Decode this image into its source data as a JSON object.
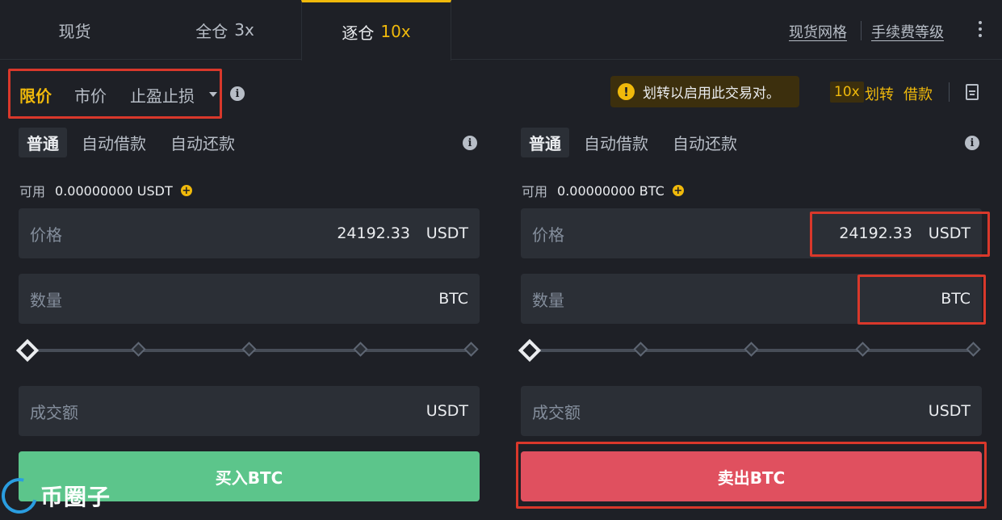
{
  "top_tabs": [
    {
      "label": "现货",
      "mult": ""
    },
    {
      "label": "全仓",
      "mult": "3x"
    },
    {
      "label": "逐仓",
      "mult": "10x"
    }
  ],
  "top_links": {
    "grid": "现货网格",
    "fee": "手续费等级"
  },
  "order_types": {
    "limit": "限价",
    "market": "市价",
    "stop": "止盈止损"
  },
  "notice": "划转以启用此交易对。",
  "leverage_badge": "10x",
  "transfer_label": "划转",
  "borrow_label": "借款",
  "buy_panel": {
    "modes": [
      "普通",
      "自动借款",
      "自动还款"
    ],
    "avail_label": "可用",
    "avail_value": "0.00000000 USDT",
    "price_label": "价格",
    "price_value": "24192.33",
    "price_unit": "USDT",
    "qty_label": "数量",
    "qty_unit": "BTC",
    "total_label": "成交额",
    "total_unit": "USDT",
    "button": "买入BTC"
  },
  "sell_panel": {
    "modes": [
      "普通",
      "自动借款",
      "自动还款"
    ],
    "avail_label": "可用",
    "avail_value": "0.00000000 BTC",
    "price_label": "价格",
    "price_value": "24192.33",
    "price_unit": "USDT",
    "qty_label": "数量",
    "qty_unit": "BTC",
    "total_label": "成交额",
    "total_unit": "USDT",
    "button": "卖出BTC"
  },
  "slider_value_percent": 0,
  "watermark": "币圈子",
  "colors": {
    "accent": "#f0b90b",
    "buy": "#5cc58b",
    "sell": "#e0505f",
    "highlight": "#d9382b"
  }
}
